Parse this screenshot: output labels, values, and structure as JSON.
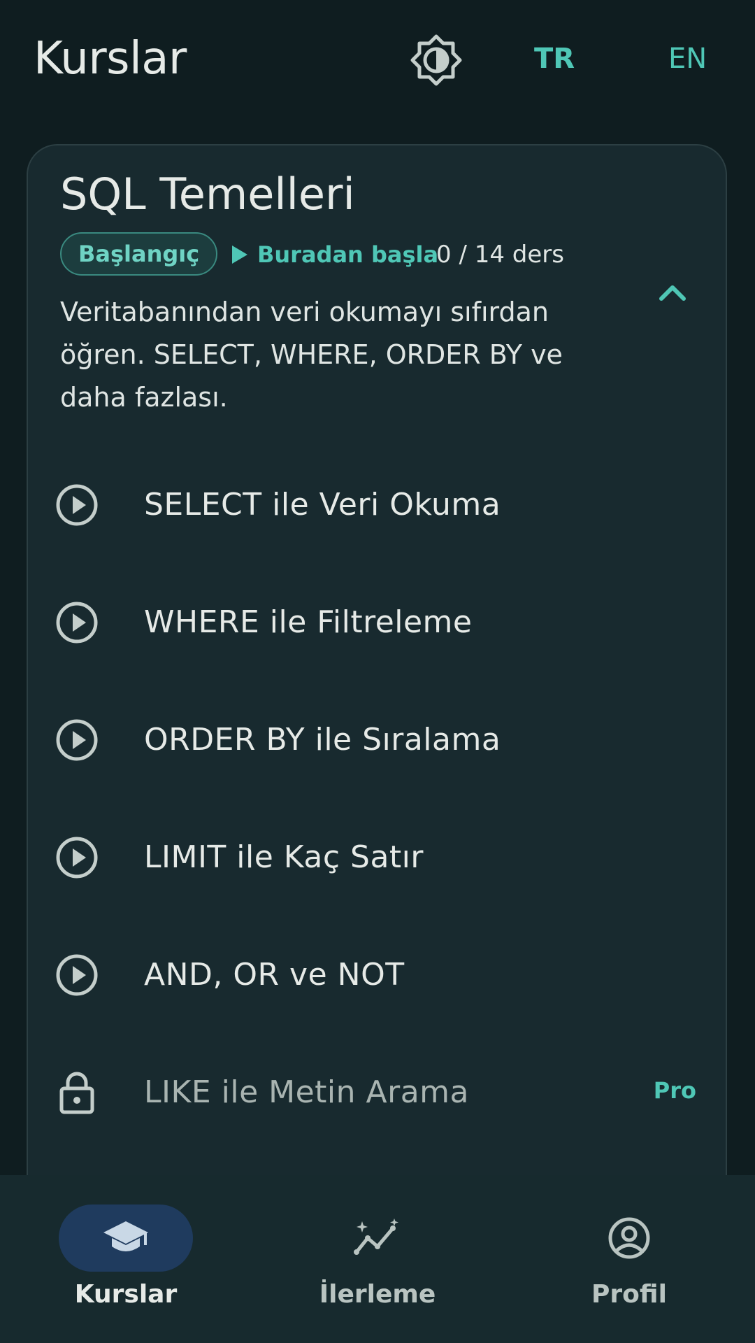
{
  "header": {
    "title": "Kurslar",
    "theme_icon": "brightness-icon",
    "lang_tr": "TR",
    "lang_en": "EN"
  },
  "course": {
    "title": "SQL Temelleri",
    "level": "Başlangıç",
    "start_label": "Buradan başla",
    "lesson_count": "0 / 14 ders",
    "description": "Veritabanından veri okumayı sıfırdan öğren. SELECT, WHERE, ORDER BY ve daha fazlası.",
    "lessons": [
      {
        "title": "SELECT ile Veri Okuma",
        "icon": "play-circle-icon",
        "locked": false
      },
      {
        "title": "WHERE ile Filtreleme",
        "icon": "play-circle-icon",
        "locked": false
      },
      {
        "title": "ORDER BY ile Sıralama",
        "icon": "play-circle-icon",
        "locked": false
      },
      {
        "title": "LIMIT ile Kaç Satır",
        "icon": "play-circle-icon",
        "locked": false
      },
      {
        "title": "AND, OR ve NOT",
        "icon": "play-circle-icon",
        "locked": false
      },
      {
        "title": "LIKE ile Metin Arama",
        "icon": "lock-icon",
        "locked": true,
        "badge": "Pro"
      }
    ]
  },
  "bottom_nav": [
    {
      "label": "Kurslar",
      "icon": "graduation-cap-icon",
      "active": true
    },
    {
      "label": "İlerleme",
      "icon": "progress-chart-icon",
      "active": false
    },
    {
      "label": "Profil",
      "icon": "profile-icon",
      "active": false
    }
  ],
  "colors": {
    "background": "#0f1d20",
    "card": "#182a2f",
    "accent": "#4fc7b6",
    "nav_active": "#1f3b5e"
  }
}
